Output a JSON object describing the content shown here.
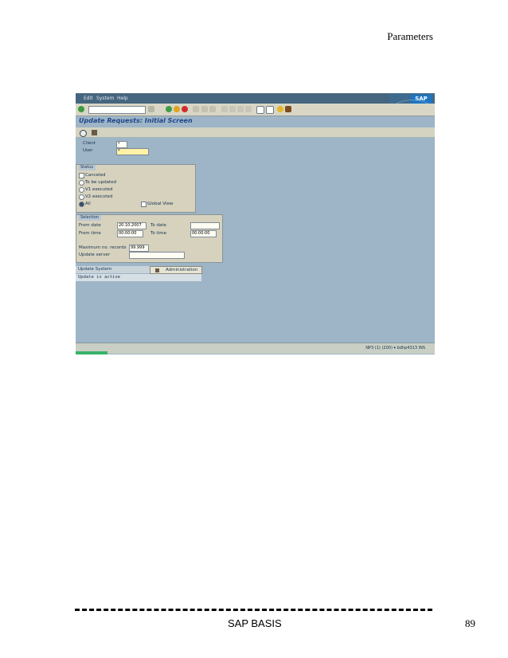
{
  "header": {
    "section": "Parameters"
  },
  "footer": {
    "title": "SAP BASIS",
    "page": "89"
  },
  "sap": {
    "menu": {
      "edit": "Edit",
      "system": "System",
      "help": "Help"
    },
    "logo": "SAP",
    "title": "Update Requests: Initial Screen",
    "client_label": "Client",
    "client_value": "*",
    "user_label": "User",
    "user_value": "*",
    "status": {
      "title": "Status",
      "canceled": "Canceled",
      "to_be_updated": "To be updated",
      "v1": "V1 executed",
      "v2": "V2 executed",
      "all": "All",
      "global_view": "Global View"
    },
    "selection": {
      "title": "Selection",
      "from_date_label": "From date",
      "from_date": "20.10.2007",
      "to_date_label": "To date",
      "from_time_label": "From time",
      "from_time": "00:00:00",
      "to_time_label": "To time",
      "to_time": "00:00:00",
      "max_label": "Maximum no. records",
      "max_value": "99.999",
      "server_label": "Update server"
    },
    "update_system": {
      "label": "Update System",
      "button": "Administration",
      "message": "Update is active"
    },
    "status_bar": {
      "info": "NP3 (1) (200)  ▾  bdhp4313  INS"
    }
  }
}
